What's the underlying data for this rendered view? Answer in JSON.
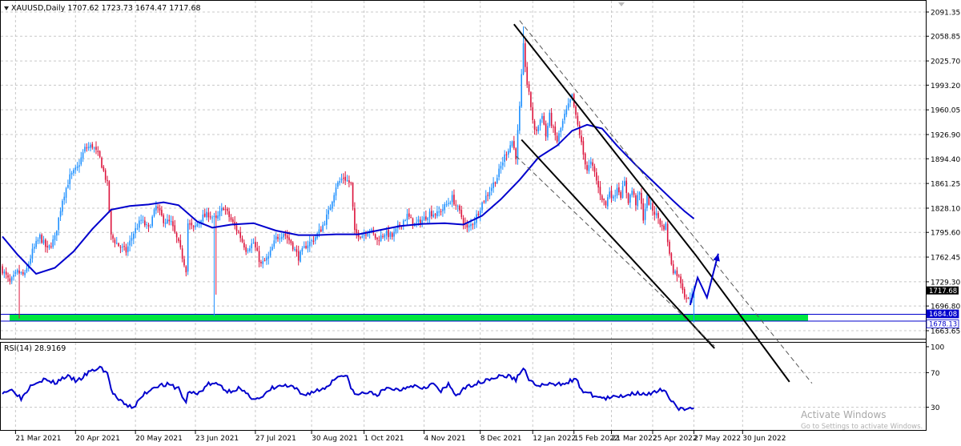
{
  "window": {
    "header": "XAUUSD,Daily  1707.62 1723.73 1674.47 1717.68",
    "watermark_line1": "Activate Windows",
    "watermark_line2": "Go to Settings to activate Windows."
  },
  "colors": {
    "up_candle": "#1e90ff",
    "down_candle": "#dc143c",
    "moving_average": "#0000cd",
    "support_zone": "#00e640",
    "current_price_label_bg": "#000000",
    "level_label_bg": "#0000cd",
    "rsi_line": "#0000cd",
    "channel_line": "#000000"
  },
  "chart_data": [
    {
      "type": "candlestick",
      "title": "XAUUSD,Daily",
      "ohlc_last": {
        "open": 1707.62,
        "high": 1723.73,
        "low": 1674.47,
        "close": 1717.68
      },
      "ylim": [
        1650,
        2100
      ],
      "y_ticks": [
        "2091.35",
        "2058.85",
        "2025.70",
        "1993.20",
        "1960.05",
        "1926.90",
        "1894.40",
        "1861.25",
        "1828.10",
        "1795.60",
        "1762.45",
        "1729.30",
        "1696.80",
        "1663.65"
      ],
      "x_ticks": [
        "21 Mar 2021",
        "20 Apr 2021",
        "20 May 2021",
        "23 Jun 2021",
        "27 Jul 2021",
        "30 Aug 2021",
        "1 Oct 2021",
        "4 Nov 2021",
        "8 Dec 2021",
        "12 Jan 2022",
        "15 Feb 2022",
        "21 Mar 2022",
        "25 Apr 2022",
        "27 May 2022",
        "30 Jun 2022"
      ],
      "price_labels": [
        {
          "label": "1717.68",
          "kind": "current"
        },
        {
          "label": "1684.08",
          "kind": "level"
        },
        {
          "label": "1678.13",
          "kind": "level"
        }
      ],
      "support_zone": [
        1678.13,
        1684.08
      ],
      "close_path": [
        {
          "i": 0,
          "c": 1745
        },
        {
          "i": 4,
          "c": 1728
        },
        {
          "i": 8,
          "c": 1742
        },
        {
          "i": 12,
          "c": 1738
        },
        {
          "i": 16,
          "c": 1770
        },
        {
          "i": 20,
          "c": 1790
        },
        {
          "i": 24,
          "c": 1772
        },
        {
          "i": 28,
          "c": 1788
        },
        {
          "i": 32,
          "c": 1840
        },
        {
          "i": 36,
          "c": 1870
        },
        {
          "i": 40,
          "c": 1882
        },
        {
          "i": 44,
          "c": 1908
        },
        {
          "i": 48,
          "c": 1912
        },
        {
          "i": 52,
          "c": 1895
        },
        {
          "i": 56,
          "c": 1860
        },
        {
          "i": 58,
          "c": 1790
        },
        {
          "i": 62,
          "c": 1778
        },
        {
          "i": 66,
          "c": 1770
        },
        {
          "i": 70,
          "c": 1795
        },
        {
          "i": 74,
          "c": 1812
        },
        {
          "i": 78,
          "c": 1800
        },
        {
          "i": 82,
          "c": 1830
        },
        {
          "i": 86,
          "c": 1812
        },
        {
          "i": 90,
          "c": 1808
        },
        {
          "i": 94,
          "c": 1780
        },
        {
          "i": 98,
          "c": 1746
        },
        {
          "i": 99,
          "c": 1808
        },
        {
          "i": 102,
          "c": 1800
        },
        {
          "i": 106,
          "c": 1815
        },
        {
          "i": 110,
          "c": 1820
        },
        {
          "i": 114,
          "c": 1812
        },
        {
          "i": 118,
          "c": 1830
        },
        {
          "i": 122,
          "c": 1812
        },
        {
          "i": 126,
          "c": 1795
        },
        {
          "i": 130,
          "c": 1773
        },
        {
          "i": 134,
          "c": 1782
        },
        {
          "i": 138,
          "c": 1752
        },
        {
          "i": 142,
          "c": 1762
        },
        {
          "i": 146,
          "c": 1788
        },
        {
          "i": 150,
          "c": 1795
        },
        {
          "i": 154,
          "c": 1782
        },
        {
          "i": 158,
          "c": 1762
        },
        {
          "i": 162,
          "c": 1778
        },
        {
          "i": 166,
          "c": 1786
        },
        {
          "i": 170,
          "c": 1800
        },
        {
          "i": 174,
          "c": 1822
        },
        {
          "i": 178,
          "c": 1858
        },
        {
          "i": 182,
          "c": 1870
        },
        {
          "i": 186,
          "c": 1860
        },
        {
          "i": 188,
          "c": 1795
        },
        {
          "i": 192,
          "c": 1792
        },
        {
          "i": 196,
          "c": 1800
        },
        {
          "i": 200,
          "c": 1785
        },
        {
          "i": 204,
          "c": 1795
        },
        {
          "i": 208,
          "c": 1790
        },
        {
          "i": 212,
          "c": 1805
        },
        {
          "i": 216,
          "c": 1818
        },
        {
          "i": 220,
          "c": 1806
        },
        {
          "i": 224,
          "c": 1812
        },
        {
          "i": 228,
          "c": 1822
        },
        {
          "i": 232,
          "c": 1820
        },
        {
          "i": 236,
          "c": 1830
        },
        {
          "i": 240,
          "c": 1842
        },
        {
          "i": 244,
          "c": 1822
        },
        {
          "i": 248,
          "c": 1800
        },
        {
          "i": 252,
          "c": 1812
        },
        {
          "i": 256,
          "c": 1835
        },
        {
          "i": 260,
          "c": 1852
        },
        {
          "i": 264,
          "c": 1870
        },
        {
          "i": 268,
          "c": 1898
        },
        {
          "i": 272,
          "c": 1918
        },
        {
          "i": 274,
          "c": 1898
        },
        {
          "i": 276,
          "c": 1962
        },
        {
          "i": 278,
          "c": 2045
        },
        {
          "i": 280,
          "c": 1995
        },
        {
          "i": 282,
          "c": 1965
        },
        {
          "i": 284,
          "c": 1930
        },
        {
          "i": 286,
          "c": 1938
        },
        {
          "i": 288,
          "c": 1955
        },
        {
          "i": 290,
          "c": 1925
        },
        {
          "i": 292,
          "c": 1952
        },
        {
          "i": 294,
          "c": 1932
        },
        {
          "i": 296,
          "c": 1918
        },
        {
          "i": 298,
          "c": 1935
        },
        {
          "i": 300,
          "c": 1952
        },
        {
          "i": 302,
          "c": 1965
        },
        {
          "i": 304,
          "c": 1978
        },
        {
          "i": 306,
          "c": 1950
        },
        {
          "i": 308,
          "c": 1928
        },
        {
          "i": 310,
          "c": 1900
        },
        {
          "i": 312,
          "c": 1880
        },
        {
          "i": 314,
          "c": 1888
        },
        {
          "i": 316,
          "c": 1875
        },
        {
          "i": 318,
          "c": 1855
        },
        {
          "i": 320,
          "c": 1842
        },
        {
          "i": 322,
          "c": 1832
        },
        {
          "i": 324,
          "c": 1852
        },
        {
          "i": 326,
          "c": 1840
        },
        {
          "i": 328,
          "c": 1858
        },
        {
          "i": 330,
          "c": 1846
        },
        {
          "i": 332,
          "c": 1862
        },
        {
          "i": 334,
          "c": 1838
        },
        {
          "i": 336,
          "c": 1852
        },
        {
          "i": 338,
          "c": 1835
        },
        {
          "i": 340,
          "c": 1848
        },
        {
          "i": 342,
          "c": 1815
        },
        {
          "i": 344,
          "c": 1842
        },
        {
          "i": 346,
          "c": 1830
        },
        {
          "i": 348,
          "c": 1822
        },
        {
          "i": 350,
          "c": 1815
        },
        {
          "i": 352,
          "c": 1802
        },
        {
          "i": 354,
          "c": 1805
        },
        {
          "i": 356,
          "c": 1765
        },
        {
          "i": 358,
          "c": 1745
        },
        {
          "i": 360,
          "c": 1740
        },
        {
          "i": 362,
          "c": 1730
        },
        {
          "i": 364,
          "c": 1712
        },
        {
          "i": 366,
          "c": 1705
        },
        {
          "i": 368,
          "c": 1716
        },
        {
          "i": 369,
          "c": 1717.68
        }
      ],
      "moving_average_path": [
        {
          "i": 0,
          "v": 1790
        },
        {
          "i": 8,
          "v": 1766
        },
        {
          "i": 18,
          "v": 1740
        },
        {
          "i": 28,
          "v": 1748
        },
        {
          "i": 38,
          "v": 1770
        },
        {
          "i": 48,
          "v": 1800
        },
        {
          "i": 58,
          "v": 1826
        },
        {
          "i": 68,
          "v": 1831
        },
        {
          "i": 78,
          "v": 1833
        },
        {
          "i": 86,
          "v": 1836
        },
        {
          "i": 94,
          "v": 1832
        },
        {
          "i": 104,
          "v": 1810
        },
        {
          "i": 112,
          "v": 1802
        },
        {
          "i": 122,
          "v": 1806
        },
        {
          "i": 134,
          "v": 1808
        },
        {
          "i": 146,
          "v": 1798
        },
        {
          "i": 158,
          "v": 1792
        },
        {
          "i": 168,
          "v": 1792
        },
        {
          "i": 178,
          "v": 1793
        },
        {
          "i": 190,
          "v": 1793
        },
        {
          "i": 200,
          "v": 1798
        },
        {
          "i": 212,
          "v": 1804
        },
        {
          "i": 224,
          "v": 1807
        },
        {
          "i": 236,
          "v": 1808
        },
        {
          "i": 246,
          "v": 1806
        },
        {
          "i": 256,
          "v": 1818
        },
        {
          "i": 266,
          "v": 1840
        },
        {
          "i": 276,
          "v": 1866
        },
        {
          "i": 286,
          "v": 1896
        },
        {
          "i": 296,
          "v": 1912
        },
        {
          "i": 304,
          "v": 1932
        },
        {
          "i": 312,
          "v": 1940
        },
        {
          "i": 320,
          "v": 1935
        },
        {
          "i": 328,
          "v": 1912
        },
        {
          "i": 338,
          "v": 1886
        },
        {
          "i": 348,
          "v": 1862
        },
        {
          "i": 358,
          "v": 1838
        },
        {
          "i": 364,
          "v": 1824
        },
        {
          "i": 369,
          "v": 1814
        }
      ],
      "series": [
        {
          "name": "",
          "kind": "channel-line",
          "points": [
            {
              "i": 273,
              "v": 2075
            },
            {
              "i": 370,
              "v": 1765
            },
            {
              "i": 420,
              "v": 1595
            }
          ]
        },
        {
          "name": "",
          "kind": "channel-line",
          "points": [
            {
              "i": 277,
              "v": 1920
            },
            {
              "i": 380,
              "v": 1640
            }
          ]
        },
        {
          "name": "",
          "kind": "channel-dashed",
          "points": [
            {
              "i": 276,
              "v": 2080
            },
            {
              "i": 432,
              "v": 1593
            }
          ]
        },
        {
          "name": "",
          "kind": "channel-dashed",
          "points": [
            {
              "i": 274,
              "v": 1898
            },
            {
              "i": 380,
              "v": 1643
            }
          ]
        },
        {
          "name": "",
          "kind": "forecast-arrow",
          "points": [
            {
              "i": 367,
              "v": 1698
            },
            {
              "i": 371,
              "v": 1735
            },
            {
              "i": 376,
              "v": 1708
            },
            {
              "i": 382,
              "v": 1767
            }
          ]
        }
      ]
    },
    {
      "type": "line",
      "title": "RSI(14) 28.9169",
      "ylim": [
        0,
        100
      ],
      "y_ticks": [
        "100",
        "70",
        "30",
        "0"
      ],
      "series": [
        {
          "name": "",
          "points": [
            {
              "i": 0,
              "v": 48
            },
            {
              "i": 6,
              "v": 50
            },
            {
              "i": 10,
              "v": 40
            },
            {
              "i": 16,
              "v": 58
            },
            {
              "i": 22,
              "v": 62
            },
            {
              "i": 28,
              "v": 58
            },
            {
              "i": 34,
              "v": 66
            },
            {
              "i": 40,
              "v": 60
            },
            {
              "i": 46,
              "v": 70
            },
            {
              "i": 52,
              "v": 76
            },
            {
              "i": 56,
              "v": 70
            },
            {
              "i": 58,
              "v": 50
            },
            {
              "i": 62,
              "v": 38
            },
            {
              "i": 66,
              "v": 32
            },
            {
              "i": 70,
              "v": 30
            },
            {
              "i": 76,
              "v": 46
            },
            {
              "i": 82,
              "v": 55
            },
            {
              "i": 88,
              "v": 56
            },
            {
              "i": 94,
              "v": 52
            },
            {
              "i": 98,
              "v": 34
            },
            {
              "i": 99,
              "v": 48
            },
            {
              "i": 104,
              "v": 45
            },
            {
              "i": 110,
              "v": 57
            },
            {
              "i": 116,
              "v": 56
            },
            {
              "i": 120,
              "v": 48
            },
            {
              "i": 126,
              "v": 52
            },
            {
              "i": 132,
              "v": 42
            },
            {
              "i": 138,
              "v": 40
            },
            {
              "i": 144,
              "v": 52
            },
            {
              "i": 150,
              "v": 55
            },
            {
              "i": 156,
              "v": 52
            },
            {
              "i": 160,
              "v": 44
            },
            {
              "i": 166,
              "v": 48
            },
            {
              "i": 172,
              "v": 52
            },
            {
              "i": 176,
              "v": 60
            },
            {
              "i": 180,
              "v": 68
            },
            {
              "i": 184,
              "v": 64
            },
            {
              "i": 188,
              "v": 44
            },
            {
              "i": 194,
              "v": 47
            },
            {
              "i": 200,
              "v": 45
            },
            {
              "i": 206,
              "v": 52
            },
            {
              "i": 212,
              "v": 50
            },
            {
              "i": 218,
              "v": 56
            },
            {
              "i": 224,
              "v": 53
            },
            {
              "i": 230,
              "v": 57
            },
            {
              "i": 234,
              "v": 48
            },
            {
              "i": 238,
              "v": 56
            },
            {
              "i": 242,
              "v": 44
            },
            {
              "i": 246,
              "v": 50
            },
            {
              "i": 250,
              "v": 56
            },
            {
              "i": 254,
              "v": 58
            },
            {
              "i": 258,
              "v": 62
            },
            {
              "i": 262,
              "v": 64
            },
            {
              "i": 266,
              "v": 66
            },
            {
              "i": 270,
              "v": 66
            },
            {
              "i": 274,
              "v": 62
            },
            {
              "i": 278,
              "v": 76
            },
            {
              "i": 280,
              "v": 66
            },
            {
              "i": 284,
              "v": 55
            },
            {
              "i": 290,
              "v": 56
            },
            {
              "i": 296,
              "v": 56
            },
            {
              "i": 302,
              "v": 60
            },
            {
              "i": 306,
              "v": 62
            },
            {
              "i": 310,
              "v": 48
            },
            {
              "i": 316,
              "v": 43
            },
            {
              "i": 322,
              "v": 40
            },
            {
              "i": 328,
              "v": 42
            },
            {
              "i": 334,
              "v": 45
            },
            {
              "i": 340,
              "v": 47
            },
            {
              "i": 346,
              "v": 45
            },
            {
              "i": 352,
              "v": 50
            },
            {
              "i": 356,
              "v": 42
            },
            {
              "i": 360,
              "v": 30
            },
            {
              "i": 364,
              "v": 26
            },
            {
              "i": 366,
              "v": 27
            },
            {
              "i": 369,
              "v": 28.9
            }
          ]
        }
      ]
    }
  ]
}
